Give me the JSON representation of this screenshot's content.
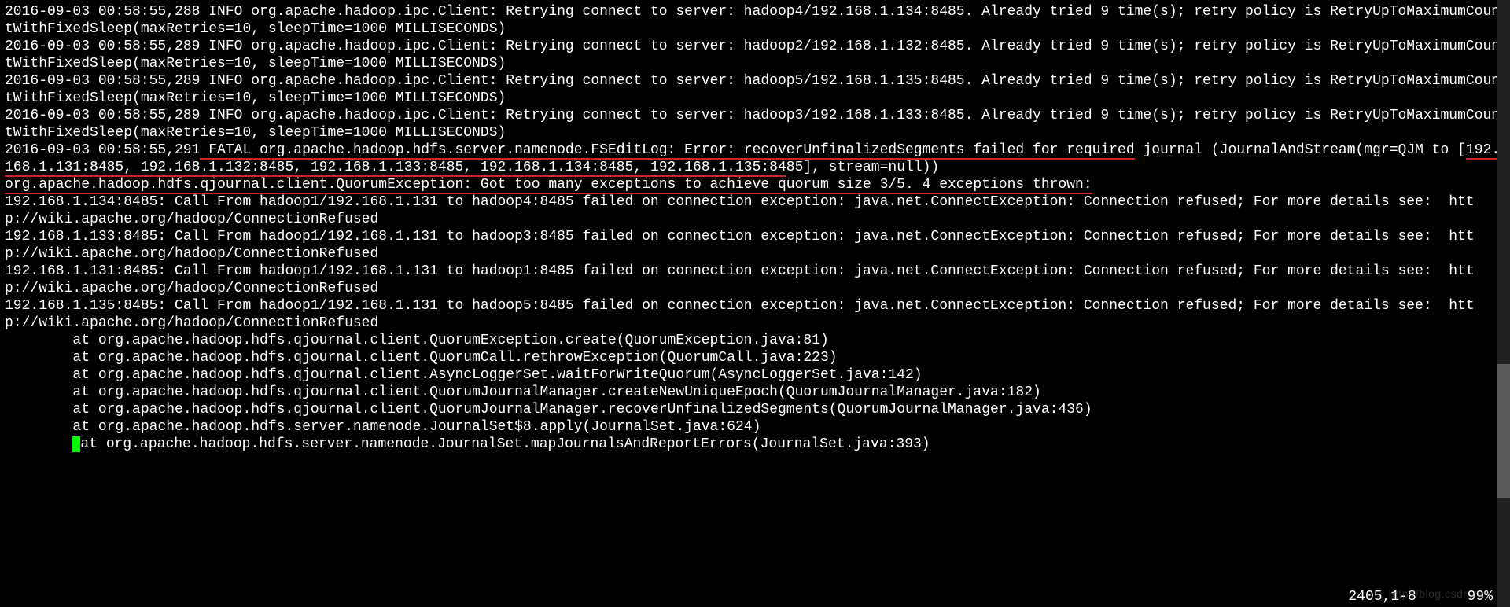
{
  "log": {
    "retry1": "2016-09-03 00:58:55,288 INFO org.apache.hadoop.ipc.Client: Retrying connect to server: hadoop4/192.168.1.134:8485. Already tried 9 time(s); retry policy is RetryUpToMaximumCountWithFixedSleep(maxRetries=10, sleepTime=1000 MILLISECONDS)",
    "retry2": "2016-09-03 00:58:55,289 INFO org.apache.hadoop.ipc.Client: Retrying connect to server: hadoop2/192.168.1.132:8485. Already tried 9 time(s); retry policy is RetryUpToMaximumCountWithFixedSleep(maxRetries=10, sleepTime=1000 MILLISECONDS)",
    "retry3": "2016-09-03 00:58:55,289 INFO org.apache.hadoop.ipc.Client: Retrying connect to server: hadoop5/192.168.1.135:8485. Already tried 9 time(s); retry policy is RetryUpToMaximumCountWithFixedSleep(maxRetries=10, sleepTime=1000 MILLISECONDS)",
    "retry4": "2016-09-03 00:58:55,289 INFO org.apache.hadoop.ipc.Client: Retrying connect to server: hadoop3/192.168.1.133:8485. Already tried 9 time(s); retry policy is RetryUpToMaximumCountWithFixedSleep(maxRetries=10, sleepTime=1000 MILLISECONDS)",
    "fatal_pre": "2016-09-03 00:58:55,291",
    "fatal_u1": " FATAL org.apache.hadoop.hdfs.server.namenode.FSEditLog: Error: recoverUnfinalizedSegments failed for required",
    "fatal_mid": " journal (JournalAndStream(mgr=QJM to [",
    "fatal_u2": "192.168.1.131:8485, 192.168.1.132:8485, ",
    "fatal_u3": "192.168.1.133:8485, 192.168.1.134:8485, 192.168.1.135:84",
    "fatal_tail": "85], stream=null))",
    "quorum_u": "org.apache.hadoop.hdfs.qjournal.client.QuorumException: Got too many exceptions to achieve quorum size 3/5. 4 exceptions thrown:",
    "ex1": "192.168.1.134:8485: Call From hadoop1/192.168.1.131 to hadoop4:8485 failed on connection exception: java.net.ConnectException: Connection refused; For more details see:  http://wiki.apache.org/hadoop/ConnectionRefused",
    "ex2": "192.168.1.133:8485: Call From hadoop1/192.168.1.131 to hadoop3:8485 failed on connection exception: java.net.ConnectException: Connection refused; For more details see:  http://wiki.apache.org/hadoop/ConnectionRefused",
    "ex3": "192.168.1.131:8485: Call From hadoop1/192.168.1.131 to hadoop1:8485 failed on connection exception: java.net.ConnectException: Connection refused; For more details see:  http://wiki.apache.org/hadoop/ConnectionRefused",
    "ex4": "192.168.1.135:8485: Call From hadoop1/192.168.1.131 to hadoop5:8485 failed on connection exception: java.net.ConnectException: Connection refused; For more details see:  http://wiki.apache.org/hadoop/ConnectionRefused",
    "st1": "        at org.apache.hadoop.hdfs.qjournal.client.QuorumException.create(QuorumException.java:81)",
    "st2": "        at org.apache.hadoop.hdfs.qjournal.client.QuorumCall.rethrowException(QuorumCall.java:223)",
    "st3": "        at org.apache.hadoop.hdfs.qjournal.client.AsyncLoggerSet.waitForWriteQuorum(AsyncLoggerSet.java:142)",
    "st4": "        at org.apache.hadoop.hdfs.qjournal.client.QuorumJournalManager.createNewUniqueEpoch(QuorumJournalManager.java:182)",
    "st5": "        at org.apache.hadoop.hdfs.qjournal.client.QuorumJournalManager.recoverUnfinalizedSegments(QuorumJournalManager.java:436)",
    "st6": "        at org.apache.hadoop.hdfs.server.namenode.JournalSet$8.apply(JournalSet.java:624)",
    "st7_pre": "        ",
    "st7_post": "at org.apache.hadoop.hdfs.server.namenode.JournalSet.mapJournalsAndReportErrors(JournalSet.java:393)"
  },
  "status": {
    "pos": "2405,1-8",
    "pct": "99%"
  },
  "watermark": "http://blog.csdn.net"
}
